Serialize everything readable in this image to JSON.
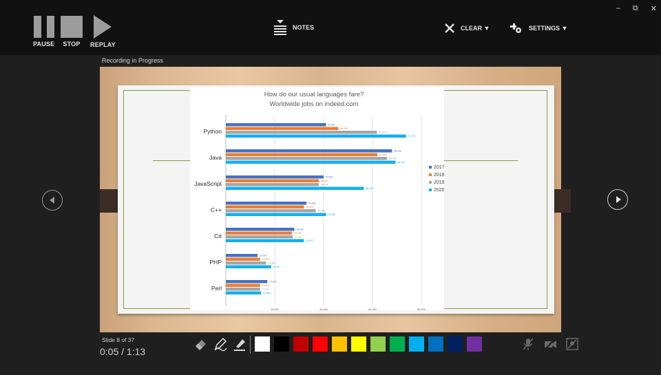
{
  "controls": {
    "pause_label": "PAUSE",
    "stop_label": "STOP",
    "replay_label": "REPLAY"
  },
  "toolbar": {
    "notes_label": "NOTES",
    "clear_label": "CLEAR ▼",
    "settings_label": "SETTINGS ▼"
  },
  "window": {
    "minimize": "–",
    "restore": "⧉",
    "close": "✕"
  },
  "status": {
    "recording": "Recording in Progress",
    "slide_counter": "Slide 8 of 37",
    "timer": "0:05 / 1:13"
  },
  "palette": [
    "#ffffff",
    "#000000",
    "#c00000",
    "#ff0000",
    "#ffc000",
    "#ffff00",
    "#92d050",
    "#00b050",
    "#00b0f0",
    "#0070c0",
    "#002060",
    "#7030a0"
  ],
  "chart_data": {
    "type": "bar",
    "orientation": "horizontal",
    "title": "How do our usual languages fare?",
    "subtitle": "Worldwide jobs on indeed.com",
    "categories": [
      "Python",
      "Java",
      "JavaScript",
      "C++",
      "C#",
      "PHP",
      "Perl"
    ],
    "series": [
      {
        "name": "2017",
        "color": "#4472c4",
        "values": [
          41000,
          68000,
          40000,
          33000,
          28000,
          13000,
          17000
        ]
      },
      {
        "name": "2018",
        "color": "#ed7d31",
        "values": [
          46000,
          62000,
          38000,
          32000,
          27000,
          14000,
          14000
        ]
      },
      {
        "name": "2019",
        "color": "#a5a5a5",
        "values": [
          61819,
          65986,
          38018,
          36758,
          27321,
          16450,
          14022
        ]
      },
      {
        "name": "2020",
        "color": "#12b0ef",
        "values": [
          73731,
          69420,
          56449,
          41026,
          31927,
          18527,
          14368
        ]
      }
    ],
    "data_labels": [
      [
        "41,000",
        "46,000",
        "61,819",
        "73,731"
      ],
      [
        "68,000",
        "62,000",
        "65,986",
        "69,420"
      ],
      [
        "40,000",
        "38,000",
        "38,018",
        "56,449"
      ],
      [
        "33,000",
        "32,000",
        "36,758",
        "41,026"
      ],
      [
        "28,000",
        "27,000",
        "27,321",
        "31,927"
      ],
      [
        "13,000",
        "14,000",
        "16,450",
        "18,527"
      ],
      [
        "17,000",
        "14,000",
        "14,022",
        "14,368"
      ]
    ],
    "xlim": [
      0,
      80000
    ],
    "xticks": [
      0,
      20000,
      40000,
      60000,
      80000
    ],
    "xtick_labels": [
      "-",
      "20,000",
      "40,000",
      "60,000",
      "80,000"
    ],
    "grid": true,
    "legend": "right"
  }
}
